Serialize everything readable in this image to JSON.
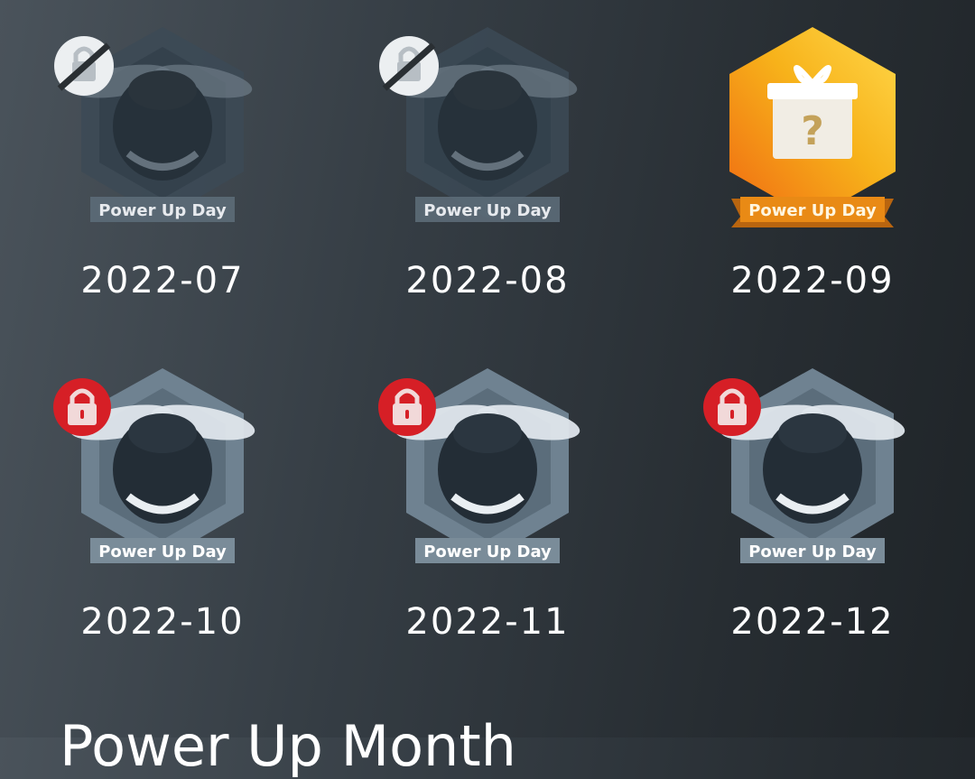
{
  "badges": [
    {
      "month": "2022-07",
      "banner": "Power Up Day",
      "status": "hidden",
      "status_icon": "eye-off-lock-icon",
      "variant": "dim"
    },
    {
      "month": "2022-08",
      "banner": "Power Up Day",
      "status": "hidden",
      "status_icon": "eye-off-lock-icon",
      "variant": "dim"
    },
    {
      "month": "2022-09",
      "banner": "Power Up Day",
      "status": "mystery",
      "status_icon": "gift-icon",
      "variant": "gold",
      "gift_mark": "?"
    },
    {
      "month": "2022-10",
      "banner": "Power Up Day",
      "status": "locked",
      "status_icon": "red-lock-icon",
      "variant": "locked"
    },
    {
      "month": "2022-11",
      "banner": "Power Up Day",
      "status": "locked",
      "status_icon": "red-lock-icon",
      "variant": "locked"
    },
    {
      "month": "2022-12",
      "banner": "Power Up Day",
      "status": "locked",
      "status_icon": "red-lock-icon",
      "variant": "locked"
    }
  ],
  "section": {
    "heading": "Power Up Month"
  },
  "colors": {
    "gold": "#f7b21a",
    "lock_red": "#d61f26",
    "background": "#30383f"
  }
}
